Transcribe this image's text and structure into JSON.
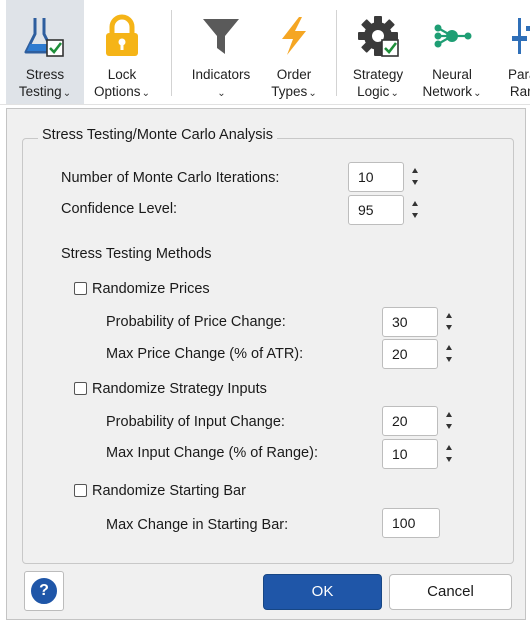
{
  "toolbar": {
    "items": [
      {
        "line1": "Stress",
        "line2": "Testing",
        "icon": "flask-icon",
        "selected": true
      },
      {
        "line1": "Lock",
        "line2": "Options",
        "icon": "lock-icon"
      },
      {
        "line1": "Indicators",
        "line2": "",
        "icon": "filter-icon"
      },
      {
        "line1": "Order",
        "line2": "Types",
        "icon": "lightning-icon"
      },
      {
        "line1": "Strategy",
        "line2": "Logic",
        "icon": "gear-icon"
      },
      {
        "line1": "Neural",
        "line2": "Network",
        "icon": "neural-network-icon"
      },
      {
        "line1": "Paran",
        "line2": "Rang",
        "icon": "parameters-icon"
      }
    ],
    "caret": "⌄"
  },
  "dialog": {
    "group_title": "Stress Testing/Monte Carlo Analysis",
    "iterations_label": "Number of Monte Carlo Iterations:",
    "iterations_value": "10",
    "confidence_label": "Confidence Level:",
    "confidence_value": "95",
    "methods_heading": "Stress Testing Methods",
    "randomize_prices": {
      "label": "Randomize Prices",
      "checked": false,
      "probability_label": "Probability of Price Change:",
      "probability_value": "30",
      "max_label": "Max Price Change (% of ATR):",
      "max_value": "20"
    },
    "randomize_inputs": {
      "label": "Randomize Strategy Inputs",
      "checked": false,
      "probability_label": "Probability of Input Change:",
      "probability_value": "20",
      "max_label": "Max Input Change (% of Range):",
      "max_value": "10"
    },
    "randomize_start": {
      "label": "Randomize Starting Bar",
      "checked": false,
      "max_label": "Max Change in Starting Bar:",
      "max_value": "100"
    }
  },
  "footer": {
    "help_glyph": "?",
    "ok_label": "OK",
    "cancel_label": "Cancel"
  },
  "colors": {
    "accent": "#1f56a8",
    "panel": "#f0f0f0",
    "lock": "#f5b417",
    "bolt": "#f5a623",
    "network": "#1e9e74",
    "parameters": "#2f6fb8"
  }
}
